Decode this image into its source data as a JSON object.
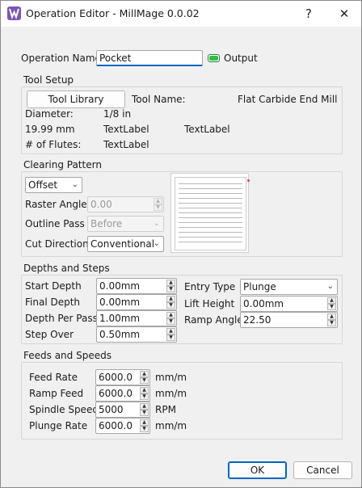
{
  "window": {
    "title": "Operation Editor - MillMage 0.0.02",
    "help_label": "?",
    "close_label": "✕",
    "icon": "millmage-app-icon"
  },
  "operation": {
    "name_label": "Operation Name",
    "name_value": "Pocket",
    "output_label": "Output",
    "output_enabled": true
  },
  "tool_setup": {
    "title": "Tool Setup",
    "library_button": "Tool Library",
    "tool_name_label": "Tool Name:",
    "tool_name_value": "Flat Carbide End Mill",
    "diameter_label": "Diameter:",
    "diameter_value": "1/8 in",
    "diameter_mm": "19.99 mm",
    "text_label_1": "TextLabel",
    "text_label_2": "TextLabel",
    "flutes_label": "# of Flutes:",
    "flutes_value": "TextLabel"
  },
  "clearing_pattern": {
    "title": "Clearing Pattern",
    "pattern_value": "Offset",
    "raster_angle_label": "Raster Angle",
    "raster_angle_value": "0.00",
    "outline_pass_label": "Outline Pass",
    "outline_pass_value": "Before",
    "cut_direction_label": "Cut Direction",
    "cut_direction_value": "Conventional"
  },
  "depths": {
    "title": "Depths and Steps",
    "start_depth_label": "Start Depth",
    "start_depth_value": "0.00mm",
    "final_depth_label": "Final Depth",
    "final_depth_value": "0.00mm",
    "depth_per_pass_label": "Depth Per Pass",
    "depth_per_pass_value": "1.00mm",
    "step_over_label": "Step Over",
    "step_over_value": "0.50mm",
    "entry_type_label": "Entry Type",
    "entry_type_value": "Plunge",
    "lift_height_label": "Lift Height",
    "lift_height_value": "0.00mm",
    "ramp_angle_label": "Ramp Angle",
    "ramp_angle_value": "22.50"
  },
  "feeds": {
    "title": "Feeds and Speeds",
    "feed_rate_label": "Feed Rate",
    "feed_rate_value": "6000.0",
    "feed_rate_unit": "mm/m",
    "ramp_feed_label": "Ramp Feed",
    "ramp_feed_value": "6000.0",
    "ramp_feed_unit": "mm/m",
    "spindle_speed_label": "Spindle Speed",
    "spindle_speed_value": "5000",
    "spindle_speed_unit": "RPM",
    "plunge_rate_label": "Plunge Rate",
    "plunge_rate_value": "6000.0",
    "plunge_rate_unit": "mm/m"
  },
  "footer": {
    "ok_label": "OK",
    "cancel_label": "Cancel"
  },
  "colors": {
    "accent": "#0067c0",
    "toggle_on": "#2fbf4a",
    "app_icon": "#7b56b5"
  }
}
